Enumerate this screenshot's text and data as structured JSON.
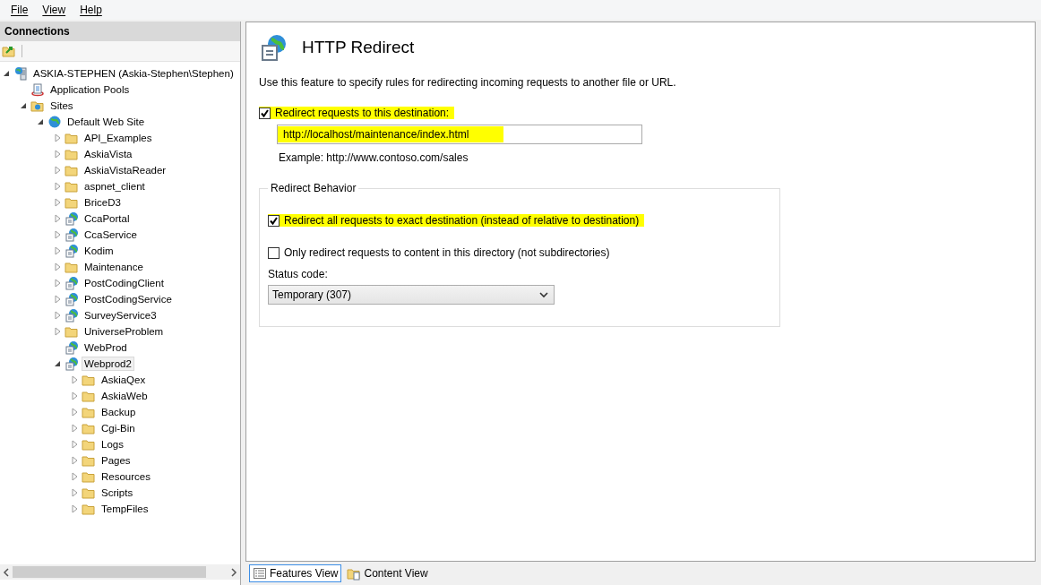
{
  "menu": [
    "File",
    "View",
    "Help"
  ],
  "connections": {
    "title": "Connections",
    "tree": [
      {
        "kind": "server",
        "label": "ASKIA-STEPHEN (Askia-Stephen\\Stephen)",
        "expanded": true,
        "selected": false,
        "children": [
          {
            "kind": "pool",
            "label": "Application Pools",
            "selected": false
          },
          {
            "kind": "sites",
            "label": "Sites",
            "expanded": true,
            "selected": false,
            "children": [
              {
                "kind": "site",
                "label": "Default Web Site",
                "expanded": true,
                "selected": false,
                "children": [
                  {
                    "kind": "folder",
                    "label": "API_Examples",
                    "expanded": false,
                    "selected": false
                  },
                  {
                    "kind": "folder",
                    "label": "AskiaVista",
                    "expanded": false,
                    "selected": false
                  },
                  {
                    "kind": "folder",
                    "label": "AskiaVistaReader",
                    "expanded": false,
                    "selected": false
                  },
                  {
                    "kind": "folder",
                    "label": "aspnet_client",
                    "expanded": false,
                    "selected": false
                  },
                  {
                    "kind": "folder",
                    "label": "BriceD3",
                    "expanded": false,
                    "selected": false
                  },
                  {
                    "kind": "app",
                    "label": "CcaPortal",
                    "expanded": false,
                    "selected": false
                  },
                  {
                    "kind": "app",
                    "label": "CcaService",
                    "expanded": false,
                    "selected": false
                  },
                  {
                    "kind": "app",
                    "label": "Kodim",
                    "expanded": false,
                    "selected": false
                  },
                  {
                    "kind": "folder",
                    "label": "Maintenance",
                    "expanded": false,
                    "selected": false
                  },
                  {
                    "kind": "app",
                    "label": "PostCodingClient",
                    "expanded": false,
                    "selected": false
                  },
                  {
                    "kind": "app",
                    "label": "PostCodingService",
                    "expanded": false,
                    "selected": false
                  },
                  {
                    "kind": "app",
                    "label": "SurveyService3",
                    "expanded": false,
                    "selected": false
                  },
                  {
                    "kind": "folder",
                    "label": "UniverseProblem",
                    "expanded": false,
                    "selected": false
                  },
                  {
                    "kind": "app",
                    "label": "WebProd",
                    "selected": false
                  },
                  {
                    "kind": "app",
                    "label": "Webprod2",
                    "expanded": true,
                    "selected": true,
                    "children": [
                      {
                        "kind": "folder",
                        "label": "AskiaQex",
                        "expanded": false,
                        "selected": false
                      },
                      {
                        "kind": "folder",
                        "label": "AskiaWeb",
                        "expanded": false,
                        "selected": false
                      },
                      {
                        "kind": "folder",
                        "label": "Backup",
                        "expanded": false,
                        "selected": false
                      },
                      {
                        "kind": "folder",
                        "label": "Cgi-Bin",
                        "expanded": false,
                        "selected": false
                      },
                      {
                        "kind": "folder",
                        "label": "Logs",
                        "expanded": false,
                        "selected": false
                      },
                      {
                        "kind": "folder",
                        "label": "Pages",
                        "expanded": false,
                        "selected": false
                      },
                      {
                        "kind": "folder",
                        "label": "Resources",
                        "expanded": false,
                        "selected": false
                      },
                      {
                        "kind": "folder",
                        "label": "Scripts",
                        "expanded": false,
                        "selected": false
                      },
                      {
                        "kind": "folder",
                        "label": "TempFiles",
                        "expanded": false,
                        "selected": false
                      }
                    ]
                  }
                ]
              }
            ]
          }
        ]
      }
    ]
  },
  "feature": {
    "title": "HTTP Redirect",
    "description": "Use this feature to specify rules for redirecting incoming requests to another file or URL.",
    "redirect_checkbox": {
      "label": "Redirect requests to this destination:",
      "checked": true,
      "highlighted": true
    },
    "destination": {
      "value": "http://localhost/maintenance/index.html",
      "highlighted": true
    },
    "example": "Example: http://www.contoso.com/sales",
    "behavior": {
      "legend": "Redirect Behavior",
      "options": [
        {
          "label": "Redirect all requests to exact destination (instead of relative to destination)",
          "checked": true,
          "highlighted": true
        },
        {
          "label": "Only redirect requests to content in this directory (not subdirectories)",
          "checked": false,
          "highlighted": false
        }
      ],
      "status_label": "Status code:",
      "status_value": "Temporary (307)"
    }
  },
  "view_tabs": [
    {
      "label": "Features View",
      "selected": true
    },
    {
      "label": "Content View",
      "selected": false
    }
  ]
}
